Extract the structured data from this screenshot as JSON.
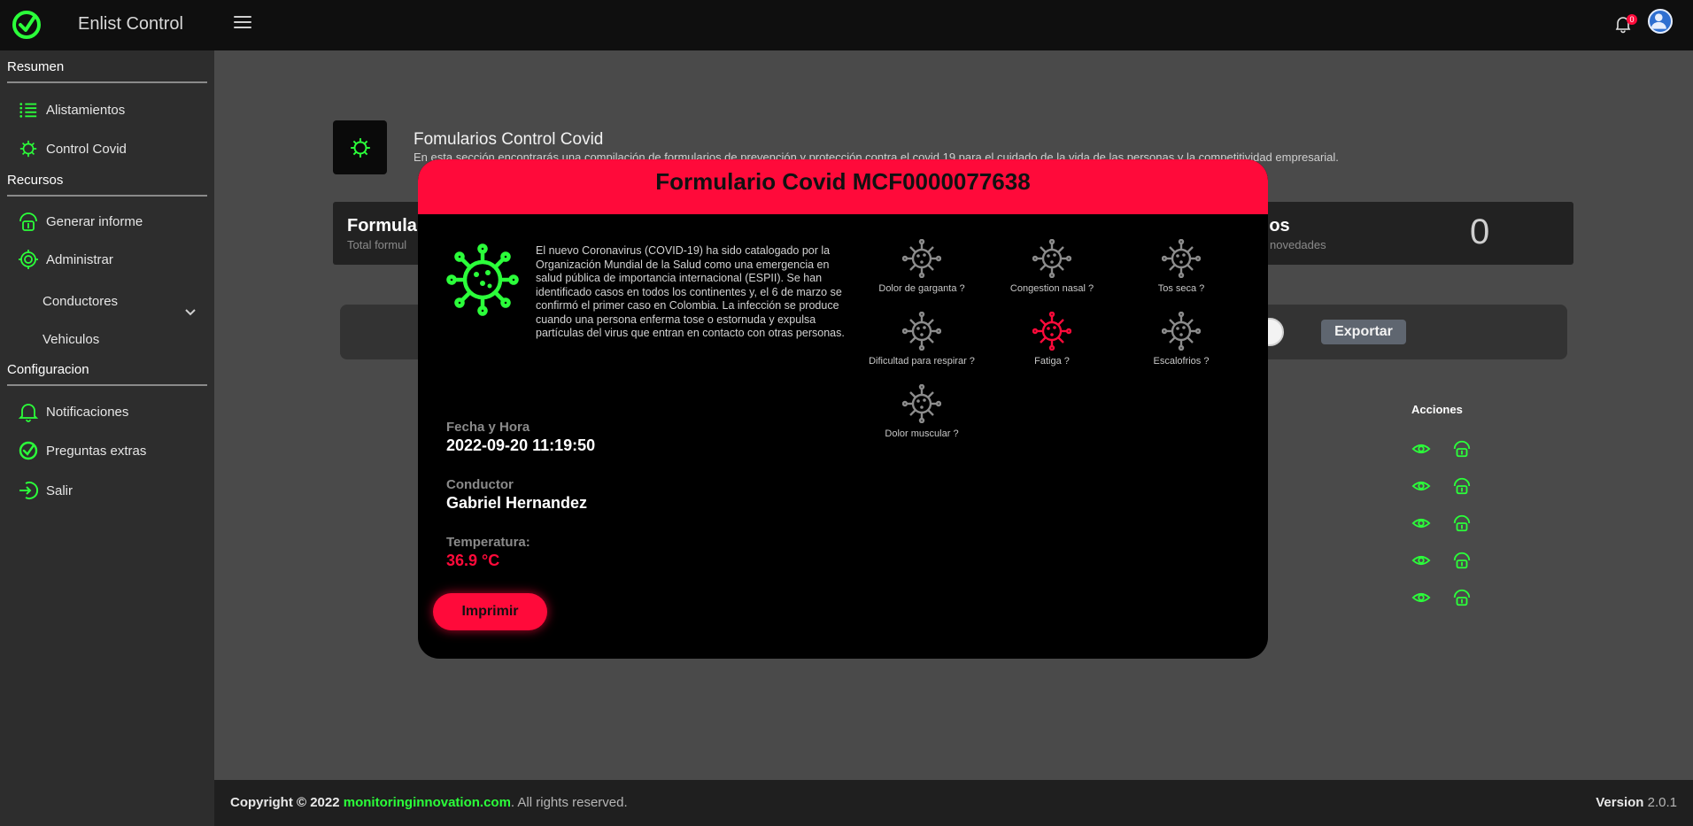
{
  "app": {
    "name": "Enlist Control",
    "notifications_count": "0"
  },
  "sidebar": {
    "sections": [
      {
        "label": "Resumen"
      },
      {
        "label": "Recursos"
      },
      {
        "label": "Configuracion"
      }
    ],
    "items": [
      {
        "label": "Alistamientos",
        "icon": "list-icon"
      },
      {
        "label": "Control Covid",
        "icon": "virus-icon"
      },
      {
        "label": "Generar informe",
        "icon": "report-icon"
      },
      {
        "label": "Administrar",
        "icon": "gear-icon"
      },
      {
        "label": "Conductores"
      },
      {
        "label": "Vehiculos"
      },
      {
        "label": "Notificaciones",
        "icon": "bell-icon"
      },
      {
        "label": "Preguntas extras",
        "icon": "check-icon"
      },
      {
        "label": "Salir",
        "icon": "logout-icon"
      }
    ]
  },
  "page": {
    "title": "Fomularios Control Covid",
    "description": "En esta sección encontrarás una compilación de formularios de prevención y protección contra el covid 19 para el cuidado de la vida de las personas y la competitividad empresarial.",
    "card_left": {
      "title": "Formula",
      "sub": "Total formul"
    },
    "card_right": {
      "title": "rios",
      "sub": "novedades",
      "count": "0"
    },
    "export_label": "Exportar",
    "actions_header": "Acciones"
  },
  "modal": {
    "title": "Formulario Covid MCF0000077638",
    "intro": "El nuevo Coronavirus (COVID-19) ha sido catalogado por la Organización Mundial de la Salud como una emergencia en salud pública de importancia internacional (ESPII). Se han identificado casos en todos los continentes y, el 6 de marzo se confirmó el primer caso en Colombia. La infección se produce cuando una persona enferma tose o estornuda y expulsa partículas del virus que entran en contacto con otras personas.",
    "symptoms": [
      {
        "label": "Dolor de garganta ?",
        "active": false
      },
      {
        "label": "Congestion nasal ?",
        "active": false
      },
      {
        "label": "Tos seca ?",
        "active": false
      },
      {
        "label": "Dificultad para respirar ?",
        "active": false
      },
      {
        "label": "Fatiga ?",
        "active": true
      },
      {
        "label": "Escalofrios ?",
        "active": false
      },
      {
        "label": "Dolor muscular ?",
        "active": false
      }
    ],
    "datetime_label": "Fecha y Hora",
    "datetime_value": "2022-09-20 11:19:50",
    "driver_label": "Conductor",
    "driver_value": "Gabriel Hernandez",
    "temp_label": "Temperatura:",
    "temp_value": "36.9 °C",
    "print_label": "Imprimir"
  },
  "footer": {
    "copyright": "Copyright © 2022",
    "domain": "monitoringinnovation.com",
    "rights": ". All rights reserved.",
    "version_label": "Version",
    "version_value": "2.0.1"
  },
  "colors": {
    "accent_green": "#2bff3a",
    "accent_red": "#ff0a3a"
  }
}
